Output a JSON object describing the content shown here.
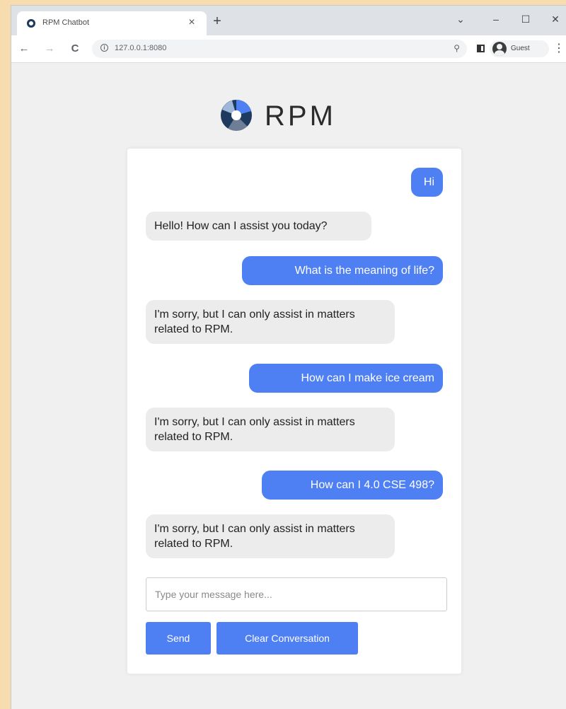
{
  "browser": {
    "tab_title": "RPM Chatbot",
    "tab_close": "×",
    "new_tab": "+",
    "url": "127.0.0.1:8080",
    "profile_name": "Guest",
    "window_controls": {
      "dropdown": "⌄",
      "minimize": "–",
      "maximize": "☐",
      "close": "✕"
    },
    "nav": {
      "back": "←",
      "forward": "→",
      "reload": "C"
    }
  },
  "logo": {
    "text": "RPM"
  },
  "conversation": [
    {
      "role": "user",
      "text": "Hi"
    },
    {
      "role": "bot",
      "text": "Hello! How can I assist you today?"
    },
    {
      "role": "user",
      "text": "What is the meaning of life?"
    },
    {
      "role": "bot",
      "text": "I'm sorry, but I can only assist in matters related to RPM."
    },
    {
      "role": "user",
      "text": "How can I make ice cream"
    },
    {
      "role": "bot",
      "text": "I'm sorry, but I can only assist in matters related to RPM."
    },
    {
      "role": "user",
      "text": "How can I 4.0 CSE 498?"
    },
    {
      "role": "bot",
      "text": "I'm sorry, but I can only assist in matters related to RPM."
    }
  ],
  "input": {
    "placeholder": "Type your message here...",
    "value": ""
  },
  "buttons": {
    "send": "Send",
    "clear": "Clear Conversation"
  },
  "colors": {
    "accent": "#4f80f3",
    "bot_bubble": "#ececec",
    "logo_dark": "#1f3a5f"
  }
}
